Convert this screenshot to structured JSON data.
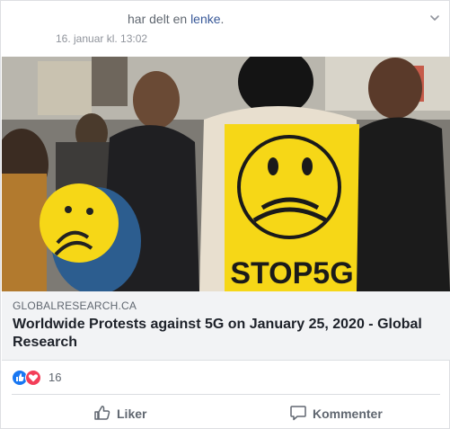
{
  "header": {
    "shared_prefix": "har delt en ",
    "shared_link": "lenke",
    "shared_suffix": ".",
    "timestamp": "16. januar kl. 13:02"
  },
  "photo": {
    "sign_text": "STOP5G"
  },
  "link_preview": {
    "domain": "GLOBALRESEARCH.CA",
    "title": "Worldwide Protests against 5G on January 25, 2020 - Global Research"
  },
  "reactions": {
    "types": [
      "like",
      "love"
    ],
    "count": "16"
  },
  "actions": {
    "like_label": "Liker",
    "comment_label": "Kommenter"
  },
  "colors": {
    "link": "#385898",
    "like_blue": "#1877f2",
    "love_red": "#f33e58",
    "sign_yellow": "#f6d717"
  }
}
